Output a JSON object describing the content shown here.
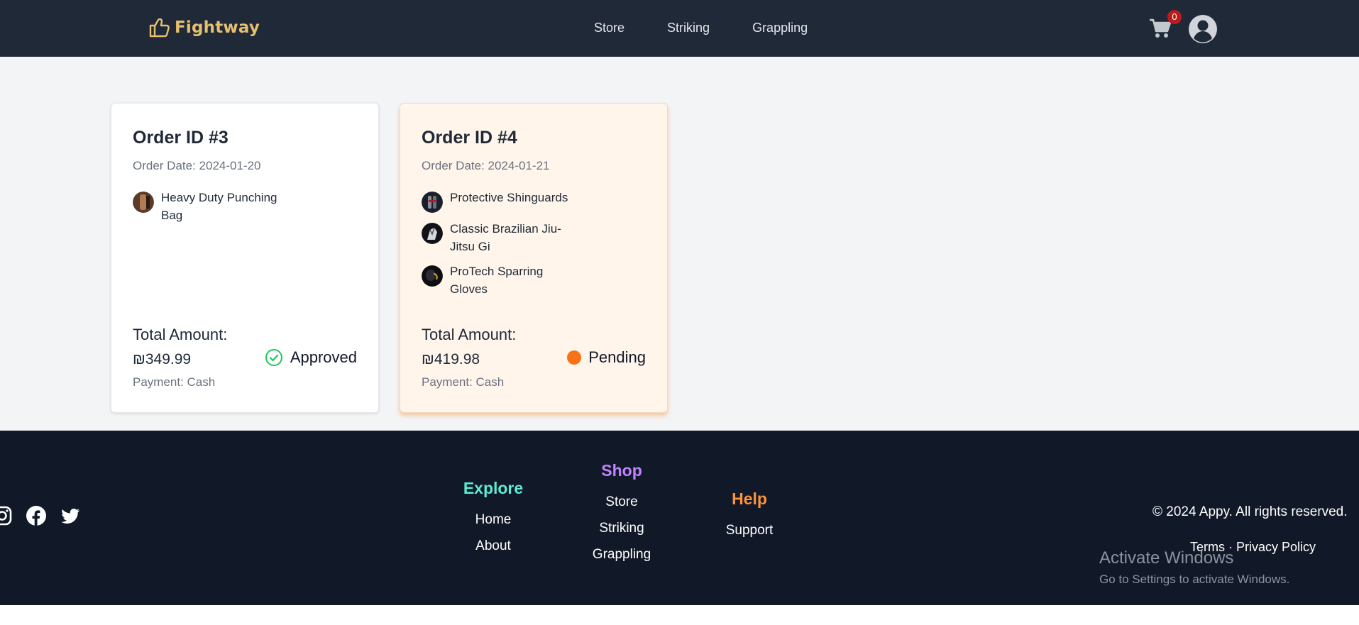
{
  "header": {
    "brand": "Fightway",
    "nav": [
      "Store",
      "Striking",
      "Grappling"
    ],
    "cart_count": "0"
  },
  "orders": [
    {
      "title": "Order ID #3",
      "date": "Order Date: 2024-01-20",
      "items": [
        "Heavy Duty Punching Bag"
      ],
      "total_label": "Total Amount:",
      "total_value": "₪349.99",
      "payment": "Payment: Cash",
      "status": "Approved",
      "status_color": "#22c55e"
    },
    {
      "title": "Order ID #4",
      "date": "Order Date: 2024-01-21",
      "items": [
        "Protective Shinguards",
        "Classic Brazilian Jiu-Jitsu Gi",
        "ProTech Sparring Gloves"
      ],
      "total_label": "Total Amount:",
      "total_value": "₪419.98",
      "payment": "Payment: Cash",
      "status": "Pending",
      "status_color": "#f97316"
    }
  ],
  "footer": {
    "explore": {
      "title": "Explore",
      "color": "#5eead4",
      "links": [
        "Home",
        "About"
      ]
    },
    "shop": {
      "title": "Shop",
      "color": "#c084fc",
      "links": [
        "Store",
        "Striking",
        "Grappling"
      ]
    },
    "help": {
      "title": "Help",
      "color": "#fb923c",
      "links": [
        "Support"
      ]
    },
    "copyright": "© 2024 Appy. All rights reserved.",
    "terms": "Terms",
    "separator": "·",
    "privacy": "Privacy Policy",
    "socials": [
      "instagram-icon",
      "facebook-icon",
      "twitter-icon"
    ]
  },
  "watermark": {
    "title": "Activate Windows",
    "subtitle": "Go to Settings to activate Windows."
  }
}
